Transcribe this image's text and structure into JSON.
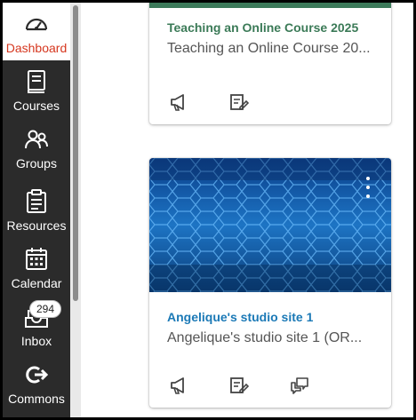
{
  "nav": {
    "dashboard": "Dashboard",
    "courses": "Courses",
    "groups": "Groups",
    "resources": "Resources",
    "calendar": "Calendar",
    "inbox": "Inbox",
    "inbox_badge": "294",
    "commons": "Commons"
  },
  "cards": [
    {
      "title": "Teaching an Online Course 2025",
      "subtitle": "Teaching an Online Course 20...",
      "color": "#3b7a57"
    },
    {
      "title": "Angelique's studio site 1",
      "subtitle": "Angelique's studio site 1 (OR...",
      "color": "#1b79b6"
    }
  ],
  "colors": {
    "nav_bg": "#2b2b2b",
    "active_label": "#d6371f",
    "text_secondary": "#555555"
  },
  "icons": {
    "announcements": "megaphone-icon",
    "assignments": "assignment-edit-icon",
    "discussions": "discussion-icon",
    "options": "kebab-menu-icon"
  }
}
